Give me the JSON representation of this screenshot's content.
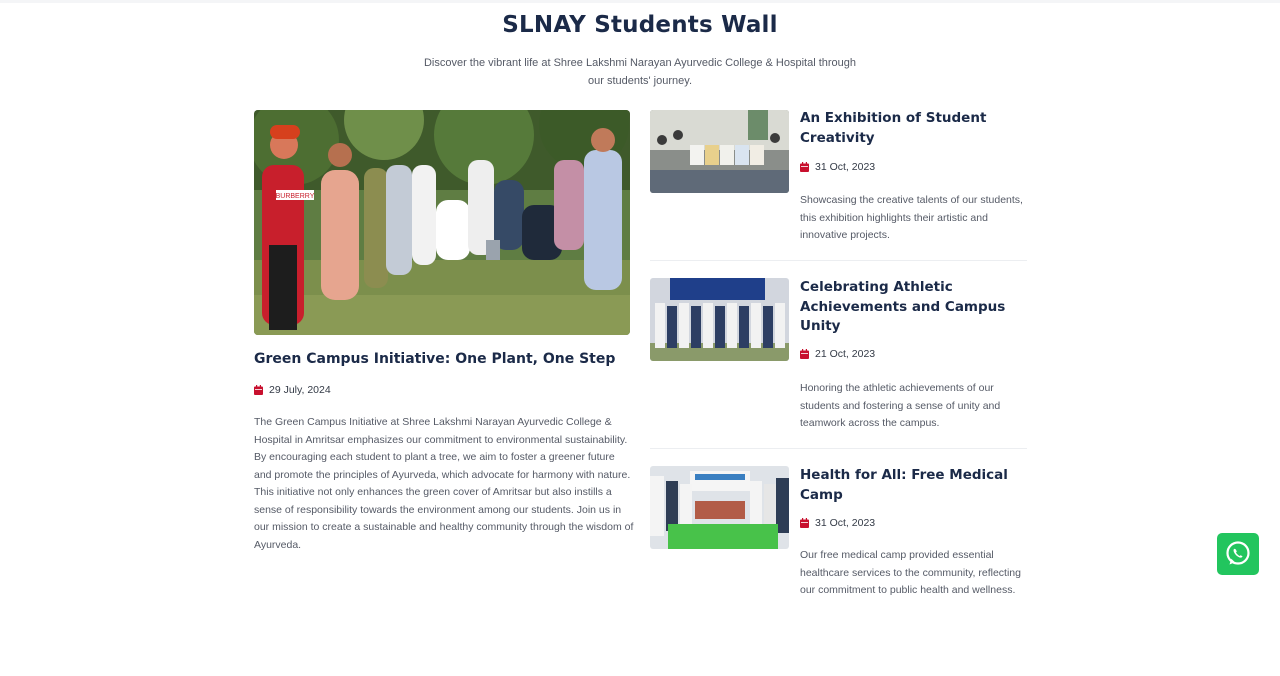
{
  "page": {
    "title": "SLNAY Students Wall",
    "subtitle": "Discover the vibrant life at Shree Lakshmi Narayan Ayurvedic College & Hospital through our students' journey."
  },
  "featured": {
    "title": "Green Campus Initiative: One Plant, One Step",
    "date": "29 July, 2024",
    "body": "The Green Campus Initiative at Shree Lakshmi Narayan Ayurvedic College & Hospital in Amritsar emphasizes our commitment to environmental sustainability. By encouraging each student to plant a tree, we aim to foster a greener future and promote the principles of Ayurveda, which advocate for harmony with nature. This initiative not only enhances the green cover of Amritsar but also instills a sense of responsibility towards the environment among our students. Join us in our mission to create a sustainable and healthy community through the wisdom of Ayurveda.",
    "photo_shirt_text": "BURBERRY"
  },
  "posts": [
    {
      "title": "An Exhibition of Student Creativity",
      "date": "31 Oct, 2023",
      "body": "Showcasing the creative talents of our students, this exhibition highlights their artistic and innovative projects."
    },
    {
      "title": "Celebrating Athletic Achievements and Campus Unity",
      "date": "21 Oct, 2023",
      "body": "Honoring the athletic achievements of our students and fostering a sense of unity and teamwork across the campus."
    },
    {
      "title": "Health for All: Free Medical Camp",
      "date": "31 Oct, 2023",
      "body": "Our free medical camp provided essential healthcare services to the community, reflecting our commitment to public health and wellness."
    }
  ],
  "icons": {
    "date": "calendar-icon",
    "whatsapp": "whatsapp-icon"
  },
  "colors": {
    "heading": "#1b2a48",
    "calendar": "#c8102e",
    "whatsapp": "#22c55e"
  }
}
